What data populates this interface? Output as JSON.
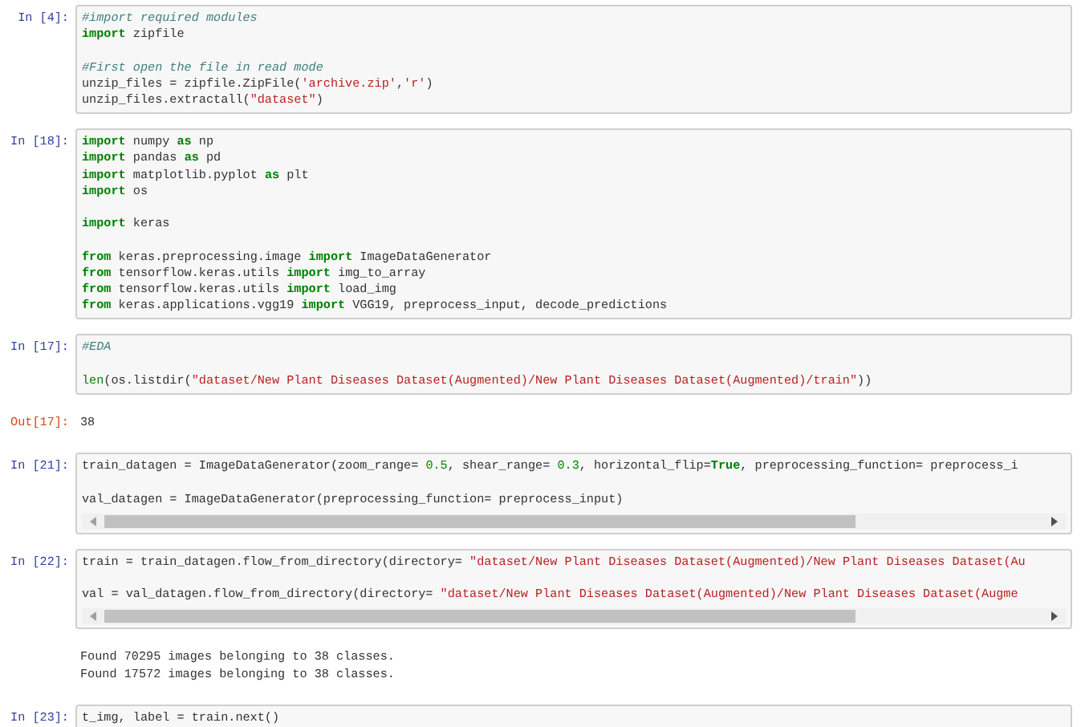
{
  "cells": [
    {
      "prompt": "In [4]:",
      "code": [
        [
          [
            {
              "kind": "comment",
              "text": "#import required modules"
            }
          ],
          [
            {
              "kind": "keyword",
              "text": "import"
            },
            {
              "kind": "plain",
              "text": " zipfile"
            }
          ]
        ],
        [
          [
            {
              "kind": "comment",
              "text": "#First open the file in read mode"
            }
          ],
          [
            {
              "kind": "plain",
              "text": "unzip_files = zipfile.ZipFile("
            },
            {
              "kind": "string",
              "text": "'archive.zip'"
            },
            {
              "kind": "plain",
              "text": ","
            },
            {
              "kind": "string",
              "text": "'r'"
            },
            {
              "kind": "plain",
              "text": ")"
            }
          ],
          [
            {
              "kind": "plain",
              "text": "unzip_files.extractall("
            },
            {
              "kind": "string",
              "text": "\"dataset\""
            },
            {
              "kind": "plain",
              "text": ")"
            }
          ]
        ]
      ]
    },
    {
      "prompt": "In [18]:",
      "code": [
        [
          [
            {
              "kind": "keyword",
              "text": "import"
            },
            {
              "kind": "plain",
              "text": " numpy "
            },
            {
              "kind": "keyword",
              "text": "as"
            },
            {
              "kind": "plain",
              "text": " np"
            }
          ],
          [
            {
              "kind": "keyword",
              "text": "import"
            },
            {
              "kind": "plain",
              "text": " pandas "
            },
            {
              "kind": "keyword",
              "text": "as"
            },
            {
              "kind": "plain",
              "text": " pd"
            }
          ],
          [
            {
              "kind": "keyword",
              "text": "import"
            },
            {
              "kind": "plain",
              "text": " matplotlib.pyplot "
            },
            {
              "kind": "keyword",
              "text": "as"
            },
            {
              "kind": "plain",
              "text": " plt"
            }
          ],
          [
            {
              "kind": "keyword",
              "text": "import"
            },
            {
              "kind": "plain",
              "text": " os"
            }
          ]
        ],
        [
          [
            {
              "kind": "keyword",
              "text": "import"
            },
            {
              "kind": "plain",
              "text": " keras"
            }
          ]
        ],
        [
          [
            {
              "kind": "keyword",
              "text": "from"
            },
            {
              "kind": "plain",
              "text": " keras.preprocessing.image "
            },
            {
              "kind": "keyword",
              "text": "import"
            },
            {
              "kind": "plain",
              "text": " ImageDataGenerator"
            }
          ],
          [
            {
              "kind": "keyword",
              "text": "from"
            },
            {
              "kind": "plain",
              "text": " tensorflow.keras.utils "
            },
            {
              "kind": "keyword",
              "text": "import"
            },
            {
              "kind": "plain",
              "text": " img_to_array"
            }
          ],
          [
            {
              "kind": "keyword",
              "text": "from"
            },
            {
              "kind": "plain",
              "text": " tensorflow.keras.utils "
            },
            {
              "kind": "keyword",
              "text": "import"
            },
            {
              "kind": "plain",
              "text": " load_img"
            }
          ],
          [
            {
              "kind": "keyword",
              "text": "from"
            },
            {
              "kind": "plain",
              "text": " keras.applications.vgg19 "
            },
            {
              "kind": "keyword",
              "text": "import"
            },
            {
              "kind": "plain",
              "text": " VGG19, preprocess_input, decode_predictions"
            }
          ]
        ]
      ]
    },
    {
      "prompt": "In [17]:",
      "code": [
        [
          [
            {
              "kind": "comment",
              "text": "#EDA"
            }
          ]
        ],
        [
          [
            {
              "kind": "builtin",
              "text": "len"
            },
            {
              "kind": "plain",
              "text": "(os.listdir("
            },
            {
              "kind": "string",
              "text": "\"dataset/New Plant Diseases Dataset(Augmented)/New Plant Diseases Dataset(Augmented)/train\""
            },
            {
              "kind": "plain",
              "text": "))"
            }
          ]
        ]
      ],
      "outputs": [
        {
          "kind": "result",
          "prompt": "Out[17]:",
          "lines": [
            "38"
          ]
        }
      ]
    },
    {
      "prompt": "In [21]:",
      "scrollbar": true,
      "code": [
        [
          [
            {
              "kind": "plain",
              "text": "train_datagen = ImageDataGenerator(zoom_range= "
            },
            {
              "kind": "number",
              "text": "0.5"
            },
            {
              "kind": "plain",
              "text": ", shear_range= "
            },
            {
              "kind": "number",
              "text": "0.3"
            },
            {
              "kind": "plain",
              "text": ", horizontal_flip="
            },
            {
              "kind": "keyword",
              "text": "True"
            },
            {
              "kind": "plain",
              "text": ", preprocessing_function= preprocess_i"
            }
          ]
        ],
        [
          [
            {
              "kind": "plain",
              "text": "val_datagen = ImageDataGenerator(preprocessing_function= preprocess_input)"
            }
          ]
        ]
      ]
    },
    {
      "prompt": "In [22]:",
      "scrollbar": true,
      "code": [
        [
          [
            {
              "kind": "plain",
              "text": "train = train_datagen.flow_from_directory(directory= "
            },
            {
              "kind": "string",
              "text": "\"dataset/New Plant Diseases Dataset(Augmented)/New Plant Diseases Dataset(Au"
            }
          ]
        ],
        [
          [
            {
              "kind": "plain",
              "text": "val = val_datagen.flow_from_directory(directory= "
            },
            {
              "kind": "string",
              "text": "\"dataset/New Plant Diseases Dataset(Augmented)/New Plant Diseases Dataset(Augme"
            }
          ]
        ]
      ],
      "outputs": [
        {
          "kind": "stream",
          "lines": [
            "Found 70295 images belonging to 38 classes.",
            "Found 17572 images belonging to 38 classes."
          ]
        }
      ]
    },
    {
      "prompt": "In [23]:",
      "code": [
        [
          [
            {
              "kind": "plain",
              "text": "t_img, label = train.next()"
            }
          ]
        ]
      ]
    }
  ]
}
